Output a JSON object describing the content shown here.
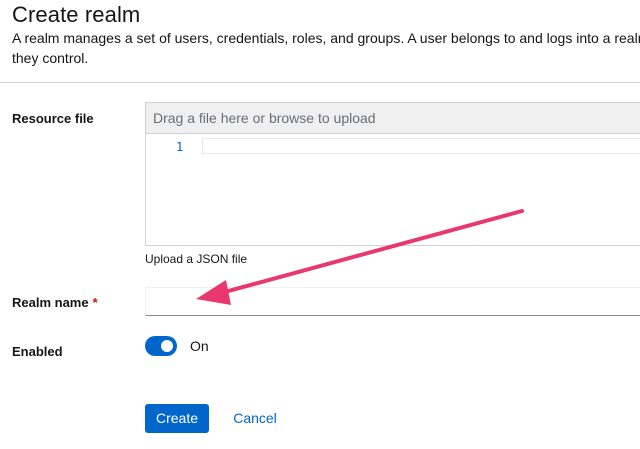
{
  "header": {
    "title": "Create realm",
    "description_line1": "A realm manages a set of users, credentials, roles, and groups. A user belongs to and logs into a realm. Realms a",
    "description_line2": "they control."
  },
  "form": {
    "resource_file": {
      "label": "Resource file",
      "placeholder": "Drag a file here or browse to upload",
      "line_number": "1",
      "helper": "Upload a JSON file"
    },
    "realm_name": {
      "label": "Realm name",
      "required_marker": "*",
      "value": ""
    },
    "enabled": {
      "label": "Enabled",
      "state": "On"
    }
  },
  "actions": {
    "create_label": "Create",
    "cancel_label": "Cancel"
  },
  "annotation": {
    "arrow_color": "#e8386d"
  }
}
